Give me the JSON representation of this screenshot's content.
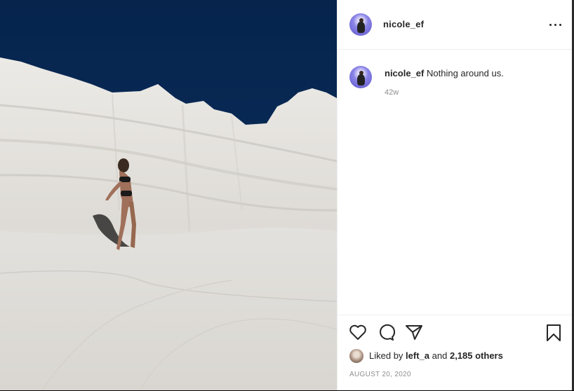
{
  "post": {
    "username": "nicole_ef",
    "caption_user": "nicole_ef",
    "caption_text": "Nothing around us.",
    "age": "42w",
    "liked_by_prefix": "Liked by",
    "liked_by_user": "left_a",
    "liked_by_and": "and",
    "likes_others": "2,185 others",
    "date": "AUGUST 20, 2020"
  },
  "icons": {
    "more": "more-options-icon",
    "like": "heart-icon",
    "comment": "comment-icon",
    "share": "paper-plane-icon",
    "save": "bookmark-icon"
  },
  "colors": {
    "sky": "#0b2a55",
    "rock": "#e4e1dc",
    "text": "#262626",
    "muted": "#8e8e8e",
    "divider": "#efefef"
  }
}
